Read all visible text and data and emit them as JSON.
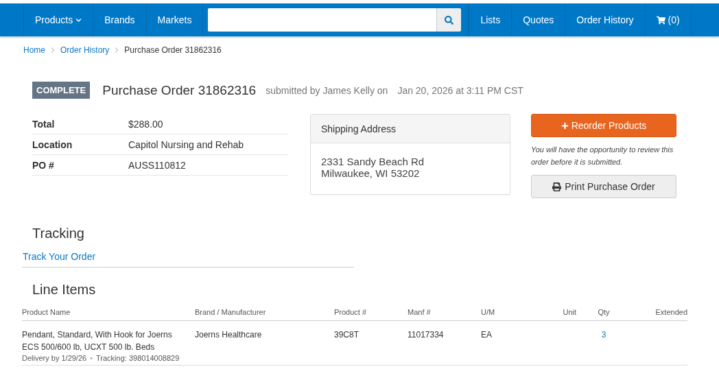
{
  "nav": {
    "left": [
      {
        "label": "Products",
        "dropdown": true
      },
      {
        "label": "Brands",
        "dropdown": false
      },
      {
        "label": "Markets",
        "dropdown": false
      }
    ],
    "right": [
      {
        "label": "Lists",
        "kind": "link"
      },
      {
        "label": "Quotes",
        "kind": "link"
      },
      {
        "label": "Order History",
        "kind": "link"
      },
      {
        "label": "(0)",
        "kind": "cart"
      }
    ]
  },
  "breadcrumb": [
    {
      "label": "Home",
      "current": false
    },
    {
      "label": "Order History",
      "current": false
    },
    {
      "label": "Purchase Order 31862316",
      "current": true
    }
  ],
  "order": {
    "status": "COMPLETE",
    "title": "Purchase Order 31862316",
    "submitted_by": "submitted by James Kelly on",
    "date": "Jan 20, 2026 at 3:11 PM CST"
  },
  "details": [
    {
      "label": "Total",
      "value": "$288.00"
    },
    {
      "label": "Location",
      "value": "Capitol Nursing and Rehab"
    },
    {
      "label": "PO #",
      "value": "AUSS110812"
    }
  ],
  "shipping": {
    "title": "Shipping Address",
    "lines": [
      "2331 Sandy Beach Rd",
      "Milwaukee, WI 53202"
    ]
  },
  "actions": {
    "reorder": "Reorder Products",
    "note": "You will have the opportunity to review this order before it is submitted.",
    "print": "Print Purchase Order"
  },
  "tracking": {
    "title": "Tracking",
    "link": "Track Your Order"
  },
  "line_items": {
    "title": "Line Items",
    "columns": [
      "Product Name",
      "Brand / Manufacturer",
      "Product #",
      "Manf #",
      "U/M",
      "Unit",
      "Qty",
      "Extended"
    ],
    "rows": [
      {
        "product_name": "Pendant, Standard, With Hook for Joerns ECS 500/600 lb, UCXT 500 lb. Beds",
        "brand": "Joerns Healthcare",
        "product_no": "39C8T",
        "manf_no": "11017334",
        "um": "EA",
        "qty": "3",
        "delivery": "Delivery by 1/29/26",
        "separator": "•",
        "tracking": "Tracking: 398014008829"
      }
    ]
  }
}
